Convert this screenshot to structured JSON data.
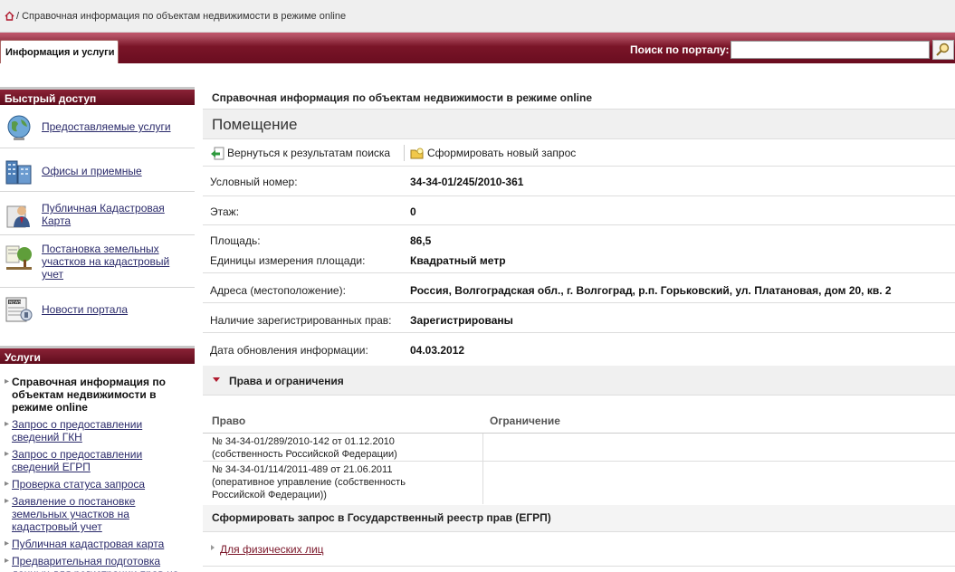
{
  "breadcrumb": {
    "text": "/ Справочная информация по объектам недвижимости в режиме online"
  },
  "nav": {
    "tab_label": "Информация и услуги",
    "search_label": "Поиск по порталу:",
    "search_value": ""
  },
  "sidebar": {
    "quick_header": "Быстрый доступ",
    "quick_items": [
      {
        "label": "Предоставляемые услуги",
        "icon": "globe-icon"
      },
      {
        "label": "Офисы и приемные",
        "icon": "buildings-icon"
      },
      {
        "label": "Публичная Кадастровая Карта",
        "icon": "person-card-icon"
      },
      {
        "label": "Постановка земельных участков на кадастровый учет",
        "icon": "tree-plot-icon"
      },
      {
        "label": "Новости портала",
        "icon": "news-icon"
      }
    ],
    "services_header": "Услуги",
    "services": [
      {
        "label": "Справочная информация по объектам недвижимости в режиме online",
        "active": true
      },
      {
        "label": "Запрос о предоставлении сведений ГКН"
      },
      {
        "label": "Запрос о предоставлении сведений ЕГРП"
      },
      {
        "label": "Проверка статуса запроса"
      },
      {
        "label": "Заявление о постановке земельных участков на кадастровый учет"
      },
      {
        "label": "Публичная кадастровая карта"
      },
      {
        "label": "Предварительная подготовка данных для регистрации прав на"
      }
    ]
  },
  "content": {
    "title": "Справочная информация по объектам недвижимости в режиме online",
    "page_heading": "Помещение",
    "actions": {
      "back": "Вернуться к результатам поиска",
      "new_request": "Сформировать новый запрос"
    },
    "fields": {
      "cond_number_label": "Условный номер:",
      "cond_number": "34-34-01/245/2010-361",
      "floor_label": "Этаж:",
      "floor": "0",
      "area_label": "Площадь:",
      "area": "86,5",
      "area_unit_label": "Единицы измерения площади:",
      "area_unit": "Квадратный метр",
      "address_label": "Адреса (местоположение):",
      "address": "Россия, Волгоградская обл., г. Волгоград, р.п. Горьковский, ул. Платановая, дом 20, кв. 2",
      "rights_label": "Наличие зарегистрированных прав:",
      "rights": "Зарегистрированы",
      "update_label": "Дата обновления информации:",
      "update": "04.03.2012"
    },
    "rights_section": {
      "header": "Права и ограничения",
      "col_right": "Право",
      "col_restriction": "Ограничение",
      "rows": [
        {
          "right": "№ 34-34-01/289/2010-142  от 01.12.2010\n (собственность Российской Федерации)"
        },
        {
          "right": "№ 34-34-01/114/2011-489  от 21.06.2011\n (оперативное управление (собственность Российской Федерации))"
        }
      ]
    },
    "egrp_header": "Сформировать запрос в Государственный реестр прав (ЕГРП)",
    "physical_link": "Для физических лиц"
  }
}
